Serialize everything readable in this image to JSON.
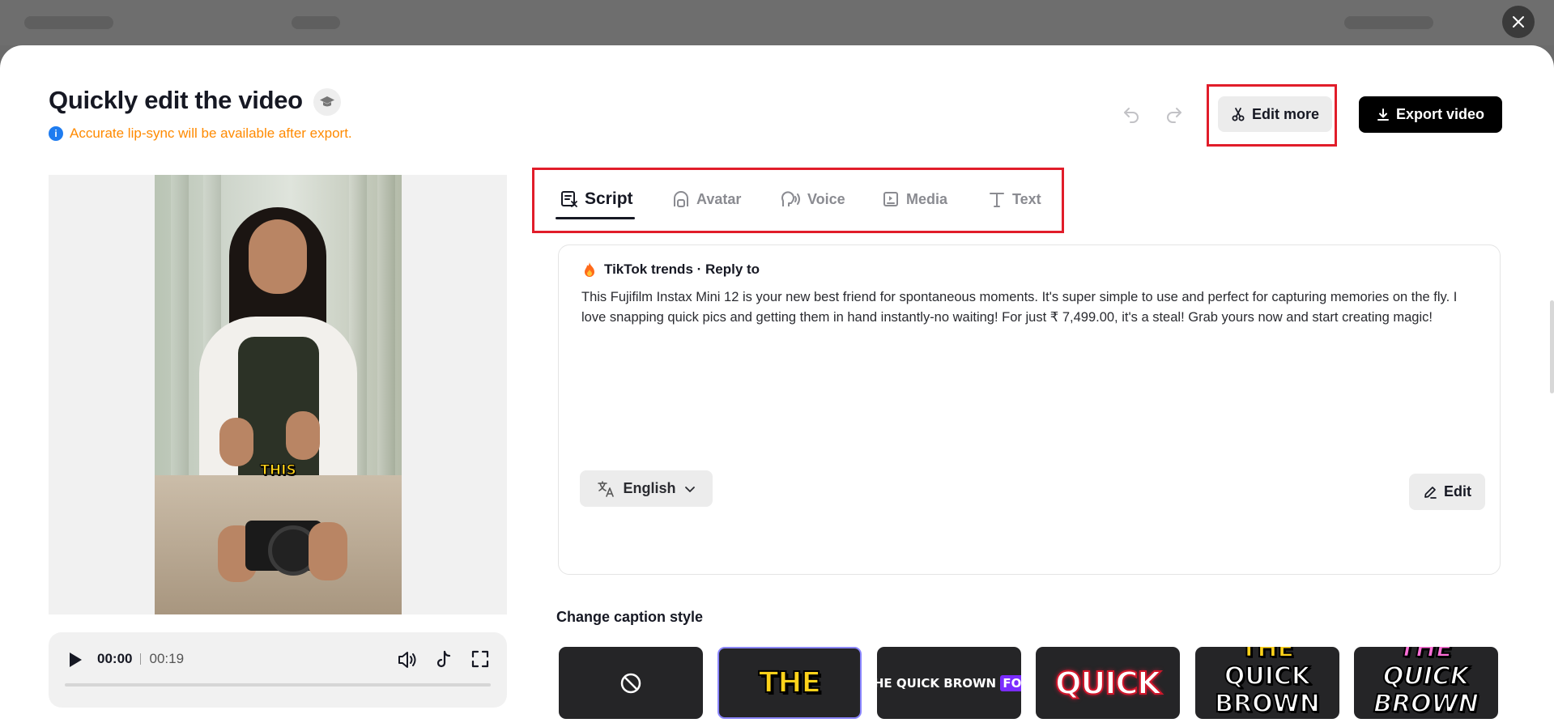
{
  "header": {
    "title": "Quickly edit the video",
    "notice": "Accurate lip-sync will be available after export.",
    "edit_more_label": "Edit more",
    "export_label": "Export video"
  },
  "preview": {
    "caption_word": "THIS",
    "current_time": "00:00",
    "duration": "00:19",
    "progress": 0
  },
  "tabs": [
    {
      "label": "Script",
      "icon": "script-icon",
      "active": true
    },
    {
      "label": "Avatar",
      "icon": "avatar-icon",
      "active": false
    },
    {
      "label": "Voice",
      "icon": "voice-icon",
      "active": false
    },
    {
      "label": "Media",
      "icon": "media-icon",
      "active": false
    },
    {
      "label": "Text",
      "icon": "text-icon",
      "active": false
    }
  ],
  "script_card": {
    "source": "TikTok trends · Reply to",
    "text": "This Fujifilm Instax Mini 12 is your new best friend for spontaneous moments. It's super simple to use and perfect for capturing memories on the fly. I love snapping quick pics and getting them in hand instantly-no waiting! For just ₹ 7,499.00, it's a steal! Grab yours now and start creating magic!",
    "language": "English",
    "edit_label": "Edit"
  },
  "caption_styles": {
    "title": "Change caption style",
    "items": [
      {
        "id": "none",
        "icon": "no-caption-icon"
      },
      {
        "id": "the-yellow",
        "text": "THE",
        "selected": true
      },
      {
        "id": "quick-brown-fox",
        "text": "THE QUICK BROWN",
        "highlight": "FOX"
      },
      {
        "id": "quick-red",
        "text": "QUICK"
      },
      {
        "id": "stack-yellow",
        "lines": [
          "THE",
          "QUICK",
          "BROWN"
        ]
      },
      {
        "id": "stack-pink",
        "lines": [
          "THE",
          "QUICK",
          "BROWN"
        ]
      }
    ]
  },
  "colors": {
    "accent_red_outline": "#e11d2a",
    "notice_orange": "#ff8a00",
    "selected_tile_border": "#8b86ff",
    "export_bg": "#000000"
  }
}
